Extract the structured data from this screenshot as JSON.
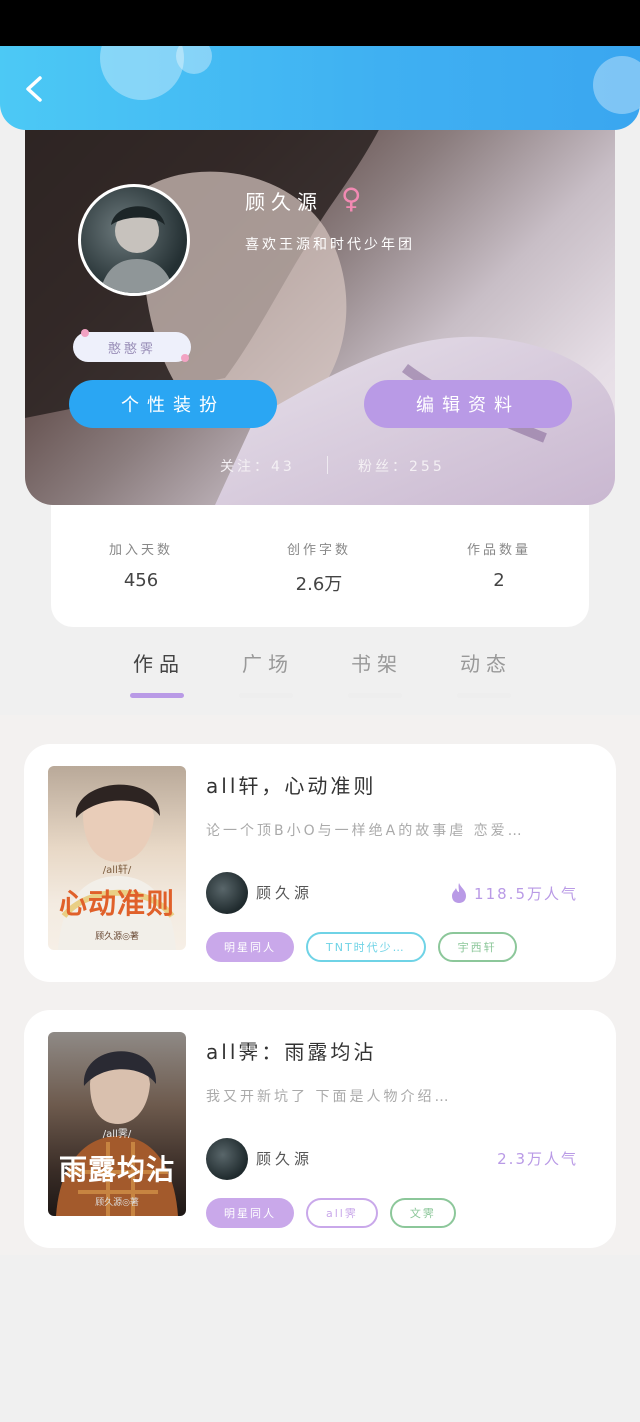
{
  "profile": {
    "username": "顾久源",
    "gender_symbol": "♀",
    "signature": "喜欢王源和时代少年团",
    "badge_label": "憨憨霁",
    "decorate_button": "个性装扮",
    "edit_button": "编辑资料",
    "following": "关注：43",
    "fans": "粉丝：255"
  },
  "stats": [
    {
      "label": "加入天数",
      "value": "456"
    },
    {
      "label": "创作字数",
      "value": "2.6万"
    },
    {
      "label": "作品数量",
      "value": "2"
    }
  ],
  "tabs": [
    {
      "label": "作品",
      "active": true
    },
    {
      "label": "广场",
      "active": false
    },
    {
      "label": "书架",
      "active": false
    },
    {
      "label": "动态",
      "active": false
    }
  ],
  "works": [
    {
      "title": "all轩，心动准则",
      "description": "论一个顶B小O与一样绝A的故事虐 恋爱…",
      "author": "顾久源",
      "popularity": "118.5万人气",
      "tags": [
        "明星同人",
        "TNT时代少…",
        "宇西轩"
      ],
      "cover_series": "/all轩/",
      "cover_title": "心动准则",
      "cover_author": "顾久源◎著"
    },
    {
      "title": "all霁：雨露均沾",
      "description": "我又开新坑了 下面是人物介绍…",
      "author": "顾久源",
      "popularity": "2.3万人气",
      "tags": [
        "明星同人",
        "all霁",
        "文霁"
      ],
      "cover_series": "/all霁/",
      "cover_title": "雨露均沾",
      "cover_author": "顾久源◎著"
    }
  ],
  "colors": {
    "header_blue": "#3fb0f2",
    "decor_button": "#2aa6f3",
    "edit_button": "#b99ae6",
    "accent_purple": "#b99ae6",
    "gender_pink": "#f28ab3"
  },
  "icons": {
    "back": "chevron-left-icon",
    "popularity": "flame-icon"
  }
}
